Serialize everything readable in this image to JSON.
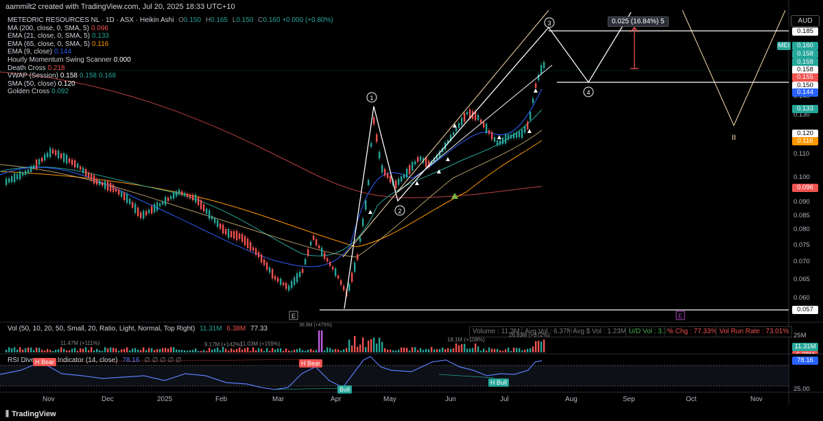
{
  "header": {
    "text": "aammilt2 created with TradingView.com, Jul 20, 2025 18:33 UTC+10"
  },
  "legend": {
    "title": "METEORIC RESOURCES NL · 1D · ASX · Heikin Ashi",
    "ohlc": {
      "o_label": "O",
      "o": "0.150",
      "h_label": "H",
      "h": "0.165",
      "l_label": "L",
      "l": "0.150",
      "c_label": "C",
      "c": "0.160",
      "chg": "+0.000 (+0.80%)"
    },
    "rows": [
      {
        "label": "MA (200, close, 0, SMA, 5)",
        "value": "0.096",
        "color": "#ef5350"
      },
      {
        "label": "EMA (21, close, 0, SMA, 5)",
        "value": "0.133",
        "color": "#26a69a"
      },
      {
        "label": "EMA (65, close, 0, SMA, 5)",
        "value": "0.116",
        "color": "#ff9800"
      },
      {
        "label": "EMA (9, close)",
        "value": "0.144",
        "color": "#2962ff"
      },
      {
        "label": "Hourly Momentum Swing Scanner",
        "value": "0.000",
        "color": "#ffffff"
      },
      {
        "label": "Death Cross",
        "value": "0.218",
        "color": "#ef5350"
      },
      {
        "label": "VWAP (Session)",
        "value": "0.158",
        "value2": "0.158",
        "value3": "0.168",
        "color": "#ffffff"
      },
      {
        "label": "SMA (50, close)",
        "value": "0.120",
        "color": "#ffffff"
      },
      {
        "label": "Golden Cross",
        "value": "0.092",
        "color": "#26a69a"
      }
    ]
  },
  "price_axis": {
    "currency": "AUD",
    "ticks": [
      "0.185",
      "0.140",
      "0.130",
      "0.110",
      "0.100",
      "0.090",
      "0.085",
      "0.080",
      "0.075",
      "0.070",
      "0.065",
      "0.060",
      "0.057"
    ],
    "badges": [
      {
        "label": "MEI",
        "value": "0.160",
        "color": "#26a69a"
      },
      {
        "value": "0.158",
        "color": "#26a69a"
      },
      {
        "value": "0.158",
        "color": "#26a69a"
      },
      {
        "value": "0.158",
        "color": "#ffffff",
        "text": "#000"
      },
      {
        "value": "0.155",
        "color": "#ef5350"
      },
      {
        "value": "0.150",
        "color": "#ffffff",
        "text": "#000"
      },
      {
        "value": "0.144",
        "color": "#2962ff"
      },
      {
        "value": "0.133",
        "color": "#26a69a"
      },
      {
        "value": "0.120",
        "color": "#ffffff",
        "text": "#000"
      },
      {
        "value": "0.116",
        "color": "#ff9800"
      },
      {
        "value": "0.096",
        "color": "#ef5350"
      },
      {
        "value": "0.057",
        "color": "#ffffff",
        "text": "#000"
      }
    ]
  },
  "measure": {
    "text": "0.025 (16.84%) 5"
  },
  "waves": {
    "w1": "1",
    "w2": "2",
    "w3": "3",
    "w4": "4",
    "wii": "II"
  },
  "markers": {
    "e1": "E",
    "e2": "E"
  },
  "volume": {
    "legend": "Vol (50, 10, 20, 50, Small, 20, Ratio, Light, Normal, Top Right)",
    "v1": "11.31M",
    "v2": "6.38M",
    "v3": "77.33",
    "stats": [
      "Volume : 11.3M",
      "Avg Vol : 6.37M",
      "Avg $ Vol : 1.23M",
      "U/D Vol : 3.2",
      "% Chg : 77.33%",
      "Vol Run Rate : 73.01%"
    ],
    "labels": [
      "11.47M (+111%)",
      "9.17M (+142%)",
      "11.03M (+159%)",
      "18.1M (+108%)",
      "26.83M (+372%)",
      "36.9M (+475%)"
    ],
    "axis": [
      "25M",
      "0"
    ],
    "badges": [
      "11.31M",
      "6.38M"
    ]
  },
  "rsi": {
    "legend": "RSI Divergence Indicator (14, close)",
    "value": "78.16",
    "nans": "∅ ∅ ∅ ∅ ∅",
    "tags": [
      {
        "t": "H Bear",
        "c": "#ef5350"
      },
      {
        "t": "H Bear",
        "c": "#ef5350"
      },
      {
        "t": "Bull",
        "c": "#26a69a"
      },
      {
        "t": "H Bull",
        "c": "#26a69a"
      }
    ],
    "axis": [
      "78.16",
      "25.00"
    ]
  },
  "time_axis": [
    "Nov",
    "Dec",
    "2025",
    "Feb",
    "Mar",
    "Apr",
    "May",
    "Jun",
    "Jul",
    "Aug",
    "Sep",
    "Oct",
    "Nov"
  ],
  "footer": {
    "brand": "TradingView"
  }
}
